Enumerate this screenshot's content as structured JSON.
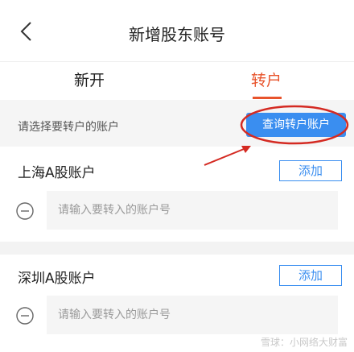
{
  "navbar": {
    "title": "新增股东账号"
  },
  "tabs": [
    {
      "label": "新开"
    },
    {
      "label": "转户"
    }
  ],
  "hint": {
    "text": "请选择要转户的账户",
    "query_button": "查询转户账户"
  },
  "sections": [
    {
      "label": "上海A股账户",
      "add_label": "添加",
      "placeholder": "请输入要转入的账户号"
    },
    {
      "label": "深圳A股账户",
      "add_label": "添加",
      "placeholder": "请输入要转入的账户号"
    }
  ],
  "watermark": "雪球：小网络大财富",
  "colors": {
    "accent": "#e8542c",
    "primary": "#3a8ef0",
    "annotation": "#d42a22"
  }
}
